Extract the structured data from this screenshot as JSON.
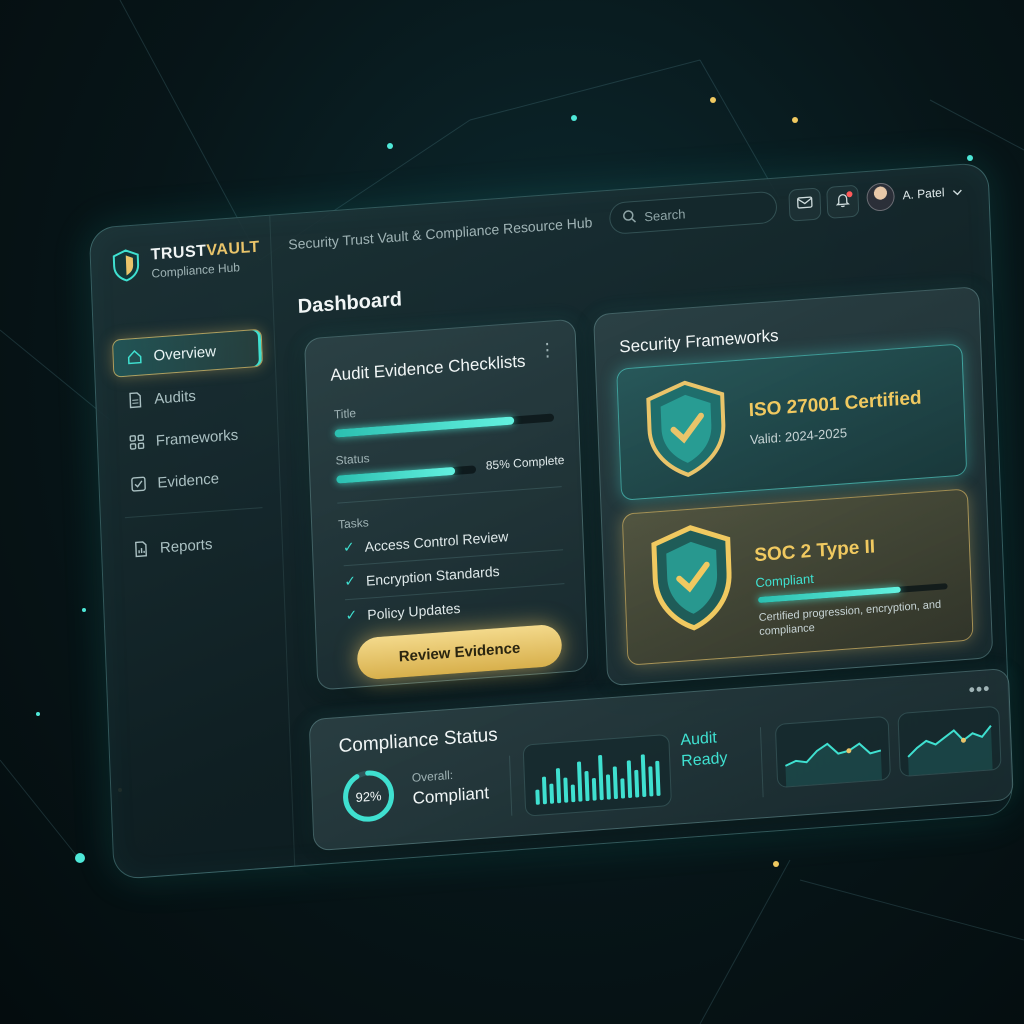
{
  "app": {
    "brand_name_a": "TRUST",
    "brand_name_b": "VAULT",
    "brand_sub": "Compliance Hub",
    "header_title": "Security Trust Vault & Compliance Resource Hub"
  },
  "search": {
    "placeholder": "Search"
  },
  "user": {
    "name": "A. Patel"
  },
  "sidebar": {
    "items": [
      {
        "label": "Overview",
        "icon": "home-icon",
        "active": true
      },
      {
        "label": "Audits",
        "icon": "document-icon"
      },
      {
        "label": "Frameworks",
        "icon": "grid-icon"
      },
      {
        "label": "Evidence",
        "icon": "checkbox-icon"
      },
      {
        "label": "Reports",
        "icon": "report-icon"
      }
    ]
  },
  "dashboard": {
    "title": "Dashboard"
  },
  "audit_card": {
    "title": "Audit Evidence Checklists",
    "title_label": "Title",
    "title_progress": 0.82,
    "status_label": "Status",
    "status_progress": 0.85,
    "status_text": "85% Complete",
    "tasks_label": "Tasks",
    "tasks": [
      "Access Control Review",
      "Encryption Standards",
      "Policy Updates"
    ],
    "button": "Review Evidence"
  },
  "frameworks_card": {
    "title": "Security Frameworks",
    "iso": {
      "name": "ISO 27001 Certified",
      "sub": "Valid: 2024-2025"
    },
    "soc": {
      "name": "SOC 2 Type II",
      "sub": "Compliant",
      "progress": 0.75,
      "desc": "Certified progression, encryption, and compliance"
    }
  },
  "status_card": {
    "title": "Compliance Status",
    "ring_value": "92%",
    "ring_fraction": 0.92,
    "overall_label": "Overall:",
    "overall_value": "Compliant",
    "audit_ready_line1": "Audit",
    "audit_ready_line2": "Ready",
    "bars": [
      0.3,
      0.55,
      0.4,
      0.7,
      0.5,
      0.35,
      0.8,
      0.6,
      0.45,
      0.9,
      0.5,
      0.65,
      0.4,
      0.75,
      0.55,
      0.85,
      0.6,
      0.7
    ],
    "spark1": [
      0.3,
      0.4,
      0.35,
      0.6,
      0.75,
      0.5,
      0.55,
      0.7,
      0.45,
      0.5
    ],
    "spark2": [
      0.25,
      0.45,
      0.6,
      0.5,
      0.65,
      0.8,
      0.55,
      0.7,
      0.6,
      0.85
    ]
  },
  "colors": {
    "accent_teal": "#3fe0d0",
    "accent_gold": "#e9c46a",
    "alert_red": "#ff5a5a"
  }
}
